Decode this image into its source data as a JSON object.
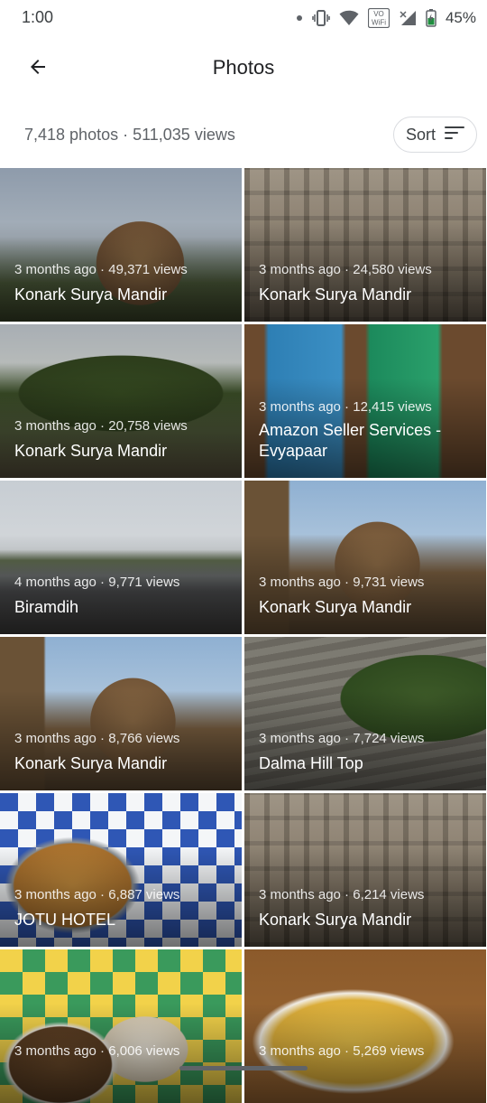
{
  "status_bar": {
    "time": "1:00",
    "battery": "45%",
    "icons": [
      "dot-icon",
      "vibrate-icon",
      "wifi-icon",
      "vowifi-icon",
      "signal-icon",
      "battery-charging-icon"
    ],
    "vowifi_label_top": "VO",
    "vowifi_label_bottom": "WiFi"
  },
  "app_bar": {
    "title": "Photos",
    "back_icon": "arrow-back-icon"
  },
  "summary": {
    "text": "7,418 photos · 511,035 views",
    "sort_label": "Sort",
    "sort_icon": "sort-lines-icon"
  },
  "photos": [
    {
      "meta": "3 months ago · 49,371 views",
      "title": "Konark Surya Mandir",
      "scene": "temple-sunset"
    },
    {
      "meta": "3 months ago · 24,580 views",
      "title": "Konark Surya Mandir",
      "scene": "carved-stone"
    },
    {
      "meta": "3 months ago · 20,758 views",
      "title": "Konark Surya Mandir",
      "scene": "garden-trees"
    },
    {
      "meta": "3 months ago · 12,415 views",
      "title": "Amazon Seller Services - Evyapaar",
      "scene": "painted-art"
    },
    {
      "meta": "4 months ago · 9,771 views",
      "title": "Biramdih",
      "scene": "railway-station"
    },
    {
      "meta": "3 months ago · 9,731 views",
      "title": "Konark Surya Mandir",
      "scene": "temple-sky"
    },
    {
      "meta": "3 months ago · 8,766 views",
      "title": "Konark Surya Mandir",
      "scene": "temple-sky"
    },
    {
      "meta": "3 months ago · 7,724 views",
      "title": "Dalma Hill Top",
      "scene": "hill-steps"
    },
    {
      "meta": "3 months ago · 6,887 views",
      "title": "JOTU HOTEL",
      "scene": "food-table"
    },
    {
      "meta": "3 months ago · 6,214 views",
      "title": "Konark Surya Mandir",
      "scene": "carved-stone"
    },
    {
      "meta": "3 months ago · 6,006 views",
      "title": "",
      "scene": "picnic-food"
    },
    {
      "meta": "3 months ago · 5,269 views",
      "title": "",
      "scene": "biryani"
    }
  ]
}
